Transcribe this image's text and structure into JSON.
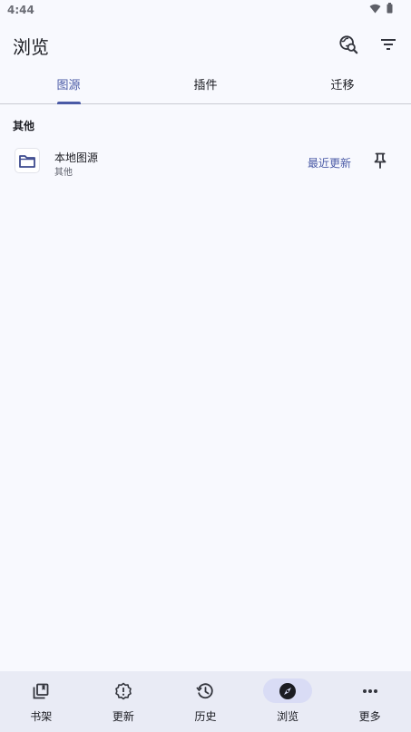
{
  "status_bar": {
    "time": "4:44"
  },
  "app_bar": {
    "title": "浏览"
  },
  "tabs": [
    {
      "label": "图源",
      "active": true
    },
    {
      "label": "插件",
      "active": false
    },
    {
      "label": "迁移",
      "active": false
    }
  ],
  "section": {
    "header": "其他"
  },
  "sources": [
    {
      "name": "本地图源",
      "language": "其他",
      "action_label": "最近更新"
    }
  ],
  "bottom_nav": [
    {
      "label": "书架",
      "icon": "library-icon",
      "active": false
    },
    {
      "label": "更新",
      "icon": "updates-icon",
      "active": false
    },
    {
      "label": "历史",
      "icon": "history-icon",
      "active": false
    },
    {
      "label": "浏览",
      "icon": "compass-icon",
      "active": true
    },
    {
      "label": "更多",
      "icon": "more-icon",
      "active": false
    }
  ],
  "colors": {
    "accent": "#4a5aa6",
    "background": "#f8f9fe",
    "nav_background": "#e9ebf5",
    "nav_active_pill": "#d9dcf5"
  }
}
